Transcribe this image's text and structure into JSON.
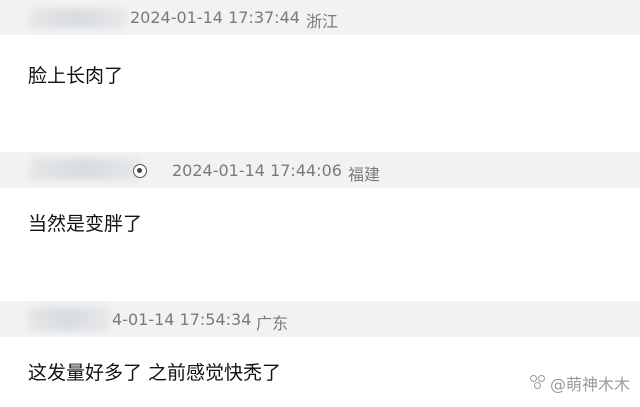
{
  "comments": [
    {
      "timestamp": "2024-01-14 17:37:44",
      "location": "浙江",
      "text": "脸上长肉了"
    },
    {
      "timestamp": "2024-01-14 17:44:06",
      "location": "福建",
      "text": "当然是变胖了"
    },
    {
      "timestamp_partial": "4-01-14 17:54:34",
      "location": "广东",
      "text": "这发量好多了 之前感觉快秃了"
    }
  ],
  "watermark": {
    "text": "@萌神木木",
    "icon": "watermark-logo-icon"
  },
  "colors": {
    "meta_bg": "#f2f2f2",
    "meta_text": "#7a7a7a",
    "comment_text": "#111111",
    "watermark_text": "#9a9a9a"
  }
}
